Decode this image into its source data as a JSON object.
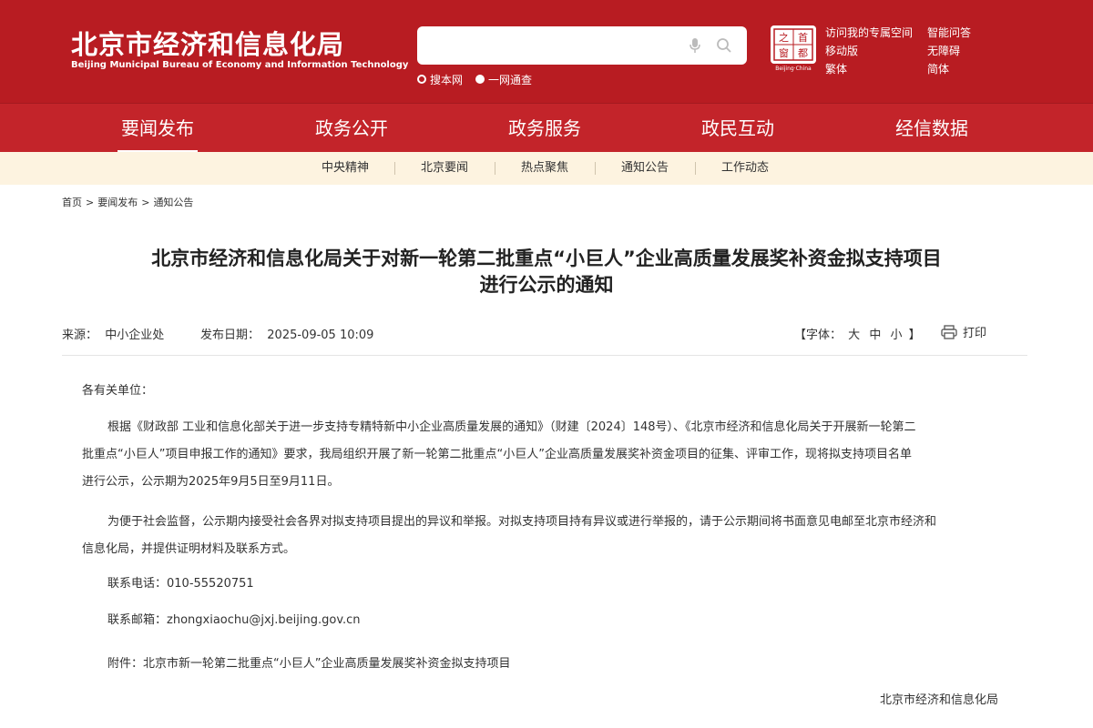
{
  "header": {
    "site_name_cn": "北京市经济和信息化局",
    "site_name_en": "Beijing Municipal Bureau of Economy and Information Technology",
    "search": {
      "placeholder": "",
      "value": ""
    },
    "search_scope": [
      "搜本网",
      "一网通查"
    ],
    "seal_caption": "Beijing·China",
    "seal_chars": [
      "之",
      "首",
      "窗",
      "都"
    ],
    "links_left": [
      "访问我的专属空间",
      "移动版",
      "繁体"
    ],
    "links_right": [
      "智能问答",
      "无障碍",
      "简体"
    ]
  },
  "main_nav": [
    "要闻发布",
    "政务公开",
    "政务服务",
    "政民互动",
    "经信数据"
  ],
  "sub_nav": [
    "中央精神",
    "北京要闻",
    "热点聚焦",
    "通知公告",
    "工作动态"
  ],
  "breadcrumb": [
    "首页",
    "要闻发布",
    "通知公告"
  ],
  "article": {
    "title_line1": "北京市经济和信息化局关于对新一轮第二批重点“小巨人”企业高质量发展奖补资金拟支持项目",
    "title_line2": "进行公示的通知",
    "source_label": "来源：",
    "source": "中小企业处",
    "date_label": "发布日期：",
    "date": "2025-09-05 10:09",
    "font_label": "【字体：",
    "font_options": [
      "大",
      "中",
      "小"
    ],
    "font_close": "】",
    "print_label": "打印",
    "salutation": "各有关单位：",
    "para1_l1": "根据《财政部 工业和信息化部关于进一步支持专精特新中小企业高质量发展的通知》（财建〔2024〕148号）、《北京市经济和信息化局关于开展新一轮第二",
    "para1_l2": "批重点“小巨人”项目申报工作的通知》要求，我局组织开展了新一轮第二批重点“小巨人”企业高质量发展奖补资金项目的征集、评审工作，现将拟支持项目名单",
    "para1_l3": "进行公示，公示期为2025年9月5日至9月11日。",
    "para2_l1": "为便于社会监督，公示期内接受社会各界对拟支持项目提出的异议和举报。对拟支持项目持有异议或进行举报的，请于公示期间将书面意见电邮至北京市经济和",
    "para2_l2": "信息化局，并提供证明材料及联系方式。",
    "phone": "联系电话：010-55520751",
    "email": "联系邮箱：zhongxiaochu@jxj.beijing.gov.cn",
    "attachment": "附件：北京市新一轮第二批重点“小巨人”企业高质量发展奖补资金拟支持项目",
    "signature": "北京市经济和信息化局"
  },
  "colors": {
    "header_red": "#b81c22",
    "nav_red": "#c3242a",
    "subnav_bg": "#fdf3e0"
  }
}
